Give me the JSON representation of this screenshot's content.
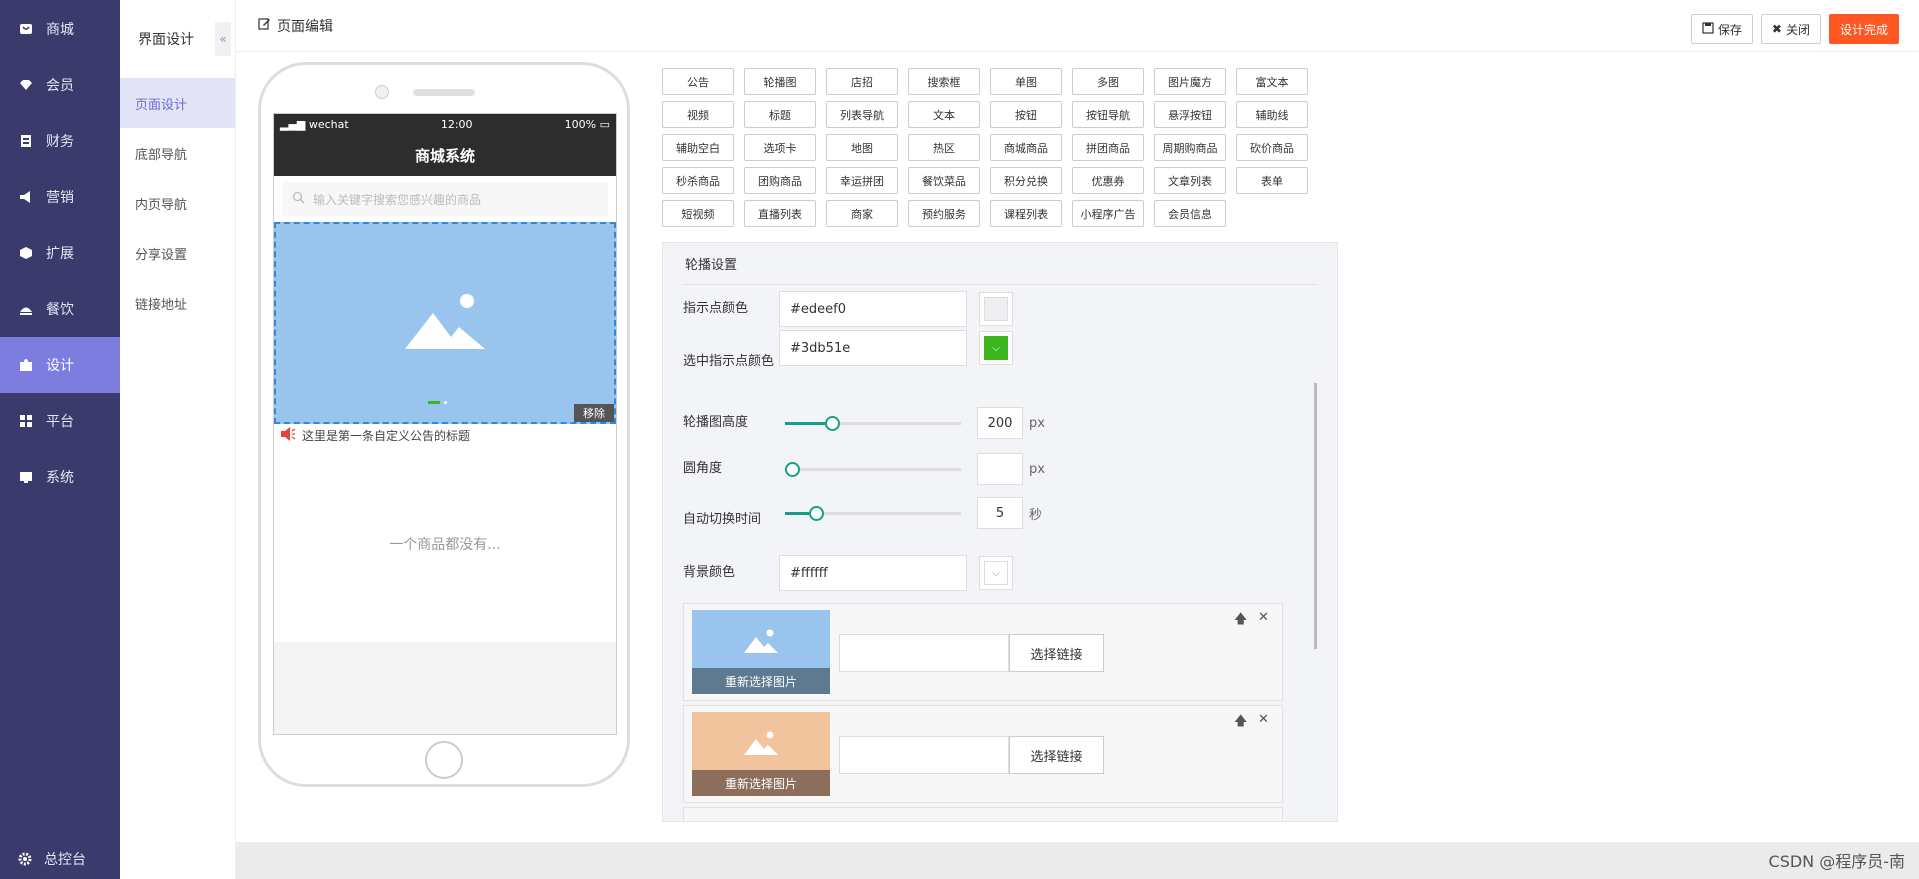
{
  "leftnav": {
    "items": [
      {
        "label": "商城",
        "icon": "shop-icon"
      },
      {
        "label": "会员",
        "icon": "member-icon"
      },
      {
        "label": "财务",
        "icon": "finance-icon"
      },
      {
        "label": "营销",
        "icon": "megaphone-icon"
      },
      {
        "label": "扩展",
        "icon": "cube-icon"
      },
      {
        "label": "餐饮",
        "icon": "dining-icon"
      },
      {
        "label": "设计",
        "icon": "puzzle-icon"
      },
      {
        "label": "平台",
        "icon": "grid-icon"
      },
      {
        "label": "系统",
        "icon": "system-icon"
      }
    ],
    "active_index": 6,
    "bottom_label": "总控台"
  },
  "subnav": {
    "title": "界面设计",
    "collapse_glyph": "«",
    "items": [
      "页面设计",
      "底部导航",
      "内页导航",
      "分享设置",
      "链接地址"
    ],
    "active_index": 0
  },
  "topbar": {
    "title": "页面编辑",
    "save_label": "保存",
    "close_label": "关闭",
    "finish_label": "设计完成"
  },
  "phone": {
    "carrier": "wechat",
    "time": "12:00",
    "battery": "100%",
    "nav_title": "商城系统",
    "search_placeholder": "输入关键字搜索您感兴趣的商品",
    "remove_label": "移除",
    "notice_text": "这里是第一条自定义公告的标题",
    "empty_text": "一个商品都没有..."
  },
  "components": [
    [
      "公告",
      "轮播图",
      "店招",
      "搜索框",
      "单图",
      "多图",
      "图片魔方",
      "富文本"
    ],
    [
      "视频",
      "标题",
      "列表导航",
      "文本",
      "按钮",
      "按钮导航",
      "悬浮按钮",
      "辅助线"
    ],
    [
      "辅助空白",
      "选项卡",
      "地图",
      "热区",
      "商城商品",
      "拼团商品",
      "周期购商品",
      "砍价商品"
    ],
    [
      "秒杀商品",
      "团购商品",
      "幸运拼团",
      "餐饮菜品",
      "积分兑换",
      "优惠券",
      "文章列表",
      "表单"
    ],
    [
      "短视频",
      "直播列表",
      "商家",
      "预约服务",
      "课程列表",
      "小程序广告",
      "会员信息"
    ]
  ],
  "settings": {
    "title": "轮播设置",
    "dot_color": {
      "label": "指示点颜色",
      "value": "#edeef0"
    },
    "active_dot_color": {
      "label": "选中指示点颜色",
      "value": "#3db51e"
    },
    "height": {
      "label": "轮播图高度",
      "value": "200",
      "unit": "px",
      "level": 0.25
    },
    "radius": {
      "label": "圆角度",
      "value": "",
      "unit": "px",
      "level": 0
    },
    "interval": {
      "label": "自动切换时间",
      "value": "5",
      "unit": "秒",
      "level": 0.15
    },
    "bg_color": {
      "label": "背景颜色",
      "value": "#ffffff"
    },
    "images": [
      {
        "reselect_label": "重新选择图片",
        "link_button": "选择链接",
        "link_value": "",
        "bg": "#98c4ee",
        "bar": "#5d7a91"
      },
      {
        "reselect_label": "重新选择图片",
        "link_button": "选择链接",
        "link_value": "",
        "bg": "#f2c49d",
        "bar": "#8b6e5b"
      }
    ]
  },
  "watermark": "CSDN @程序员-南",
  "colors": {
    "nav_bg": "#3b3a6d",
    "nav_active": "#7d7de0",
    "accent": "#ff5722",
    "slider": "#16a085"
  }
}
